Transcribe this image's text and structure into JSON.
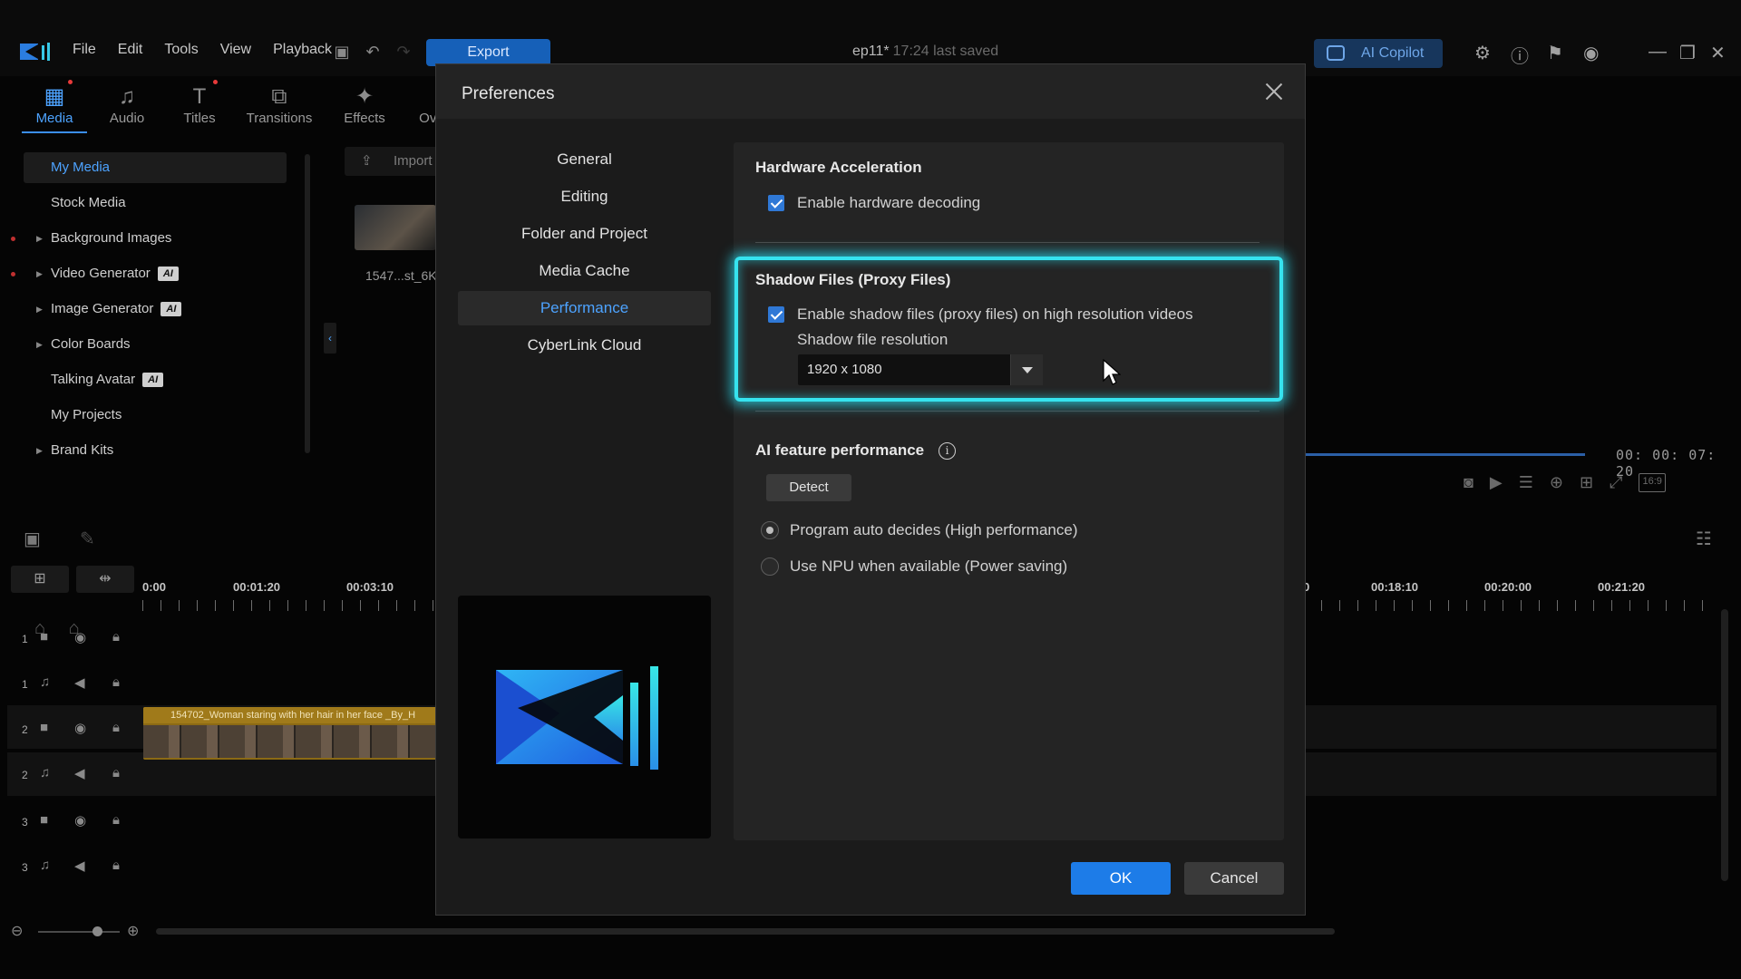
{
  "menu": [
    "File",
    "Edit",
    "Tools",
    "View",
    "Playback"
  ],
  "export_label": "Export",
  "project": {
    "name": "ep11*",
    "saved": "17:24 last saved"
  },
  "copilot_label": "AI Copilot",
  "tabs": [
    {
      "label": "Media",
      "icon": "media-icon"
    },
    {
      "label": "Audio",
      "icon": "music-note-icon"
    },
    {
      "label": "Titles",
      "icon": "title-t-icon"
    },
    {
      "label": "Transitions",
      "icon": "transition-icon"
    },
    {
      "label": "Effects",
      "icon": "effects-icon"
    },
    {
      "label": "Overlay",
      "icon": "overlay-icon"
    }
  ],
  "library": {
    "items": [
      {
        "label": "My Media"
      },
      {
        "label": "Stock Media"
      },
      {
        "label": "Background Images"
      },
      {
        "label": "Video Generator",
        "badge": "AI"
      },
      {
        "label": "Image Generator",
        "badge": "AI"
      },
      {
        "label": "Color Boards"
      },
      {
        "label": "Talking Avatar",
        "badge": "AI"
      },
      {
        "label": "My Projects"
      },
      {
        "label": "Brand Kits"
      }
    ],
    "import_label": "Import",
    "thumb_label": "1547...st_6K"
  },
  "preview": {
    "timecode": "00: 00: 07: 20",
    "aspect": "16:9"
  },
  "timeline": {
    "ruler": [
      "0:00",
      "00:01:20",
      "00:03:10",
      "0",
      "00:18:10",
      "00:20:00",
      "00:21:20"
    ],
    "tracks": [
      "1",
      "1",
      "2",
      "2",
      "3",
      "3"
    ],
    "clip_title": "154702_Woman staring with her hair in her face _By_H"
  },
  "dialog": {
    "title": "Preferences",
    "nav": [
      "General",
      "Editing",
      "Folder and Project",
      "Media Cache",
      "Performance",
      "CyberLink Cloud"
    ],
    "active_nav": "Performance",
    "hardware": {
      "title": "Hardware Acceleration",
      "checkbox_label": "Enable hardware decoding",
      "checked": true
    },
    "shadow": {
      "title": "Shadow Files (Proxy Files)",
      "checkbox_label": "Enable shadow files (proxy files) on high resolution videos",
      "checked": true,
      "resolution_label": "Shadow file resolution",
      "resolution_value": "1920 x 1080"
    },
    "ai": {
      "title": "AI feature performance",
      "detect_label": "Detect",
      "options": [
        "Program auto decides (High performance)",
        "Use NPU when available (Power saving)"
      ],
      "selected": "Program auto decides (High performance)"
    },
    "ok_label": "OK",
    "cancel_label": "Cancel"
  },
  "colors": {
    "accent": "#4da3ff",
    "highlight": "#36e3ef",
    "primary_button": "#1d7ce8"
  }
}
